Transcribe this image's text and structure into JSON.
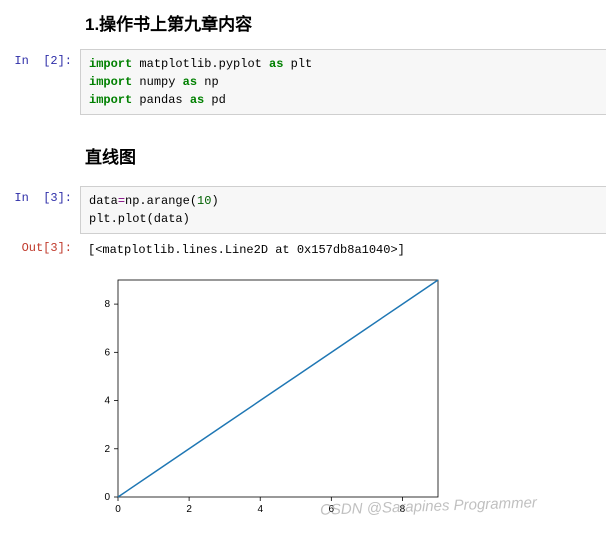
{
  "heading1": "1.操作书上第九章内容",
  "heading2": "直线图",
  "cell1": {
    "prompt": "In  [2]:",
    "code": [
      {
        "kw": "import",
        "rest": " matplotlib.pyplot ",
        "kw2": "as",
        "rest2": " plt"
      },
      {
        "kw": "import",
        "rest": " numpy ",
        "kw2": "as",
        "rest2": " np"
      },
      {
        "kw": "import",
        "rest": " pandas ",
        "kw2": "as",
        "rest2": " pd"
      }
    ]
  },
  "cell2": {
    "prompt": "In  [3]:",
    "line1_a": "data",
    "line1_b": "=",
    "line1_c": "np.arange(",
    "line1_d": "10",
    "line1_e": ")",
    "line2": "plt.plot(data)"
  },
  "out1": {
    "prompt": "Out[3]:",
    "text": "[<matplotlib.lines.Line2D at 0x157db8a1040>]"
  },
  "watermark": "CSDN @Sarapines Programmer",
  "chart_data": {
    "type": "line",
    "x": [
      0,
      1,
      2,
      3,
      4,
      5,
      6,
      7,
      8,
      9
    ],
    "y": [
      0,
      1,
      2,
      3,
      4,
      5,
      6,
      7,
      8,
      9
    ],
    "title": "",
    "xlabel": "",
    "ylabel": "",
    "xlim": [
      0,
      9
    ],
    "ylim": [
      0,
      9
    ],
    "xticks": [
      0,
      2,
      4,
      6,
      8
    ],
    "yticks": [
      0,
      2,
      4,
      6,
      8
    ]
  }
}
